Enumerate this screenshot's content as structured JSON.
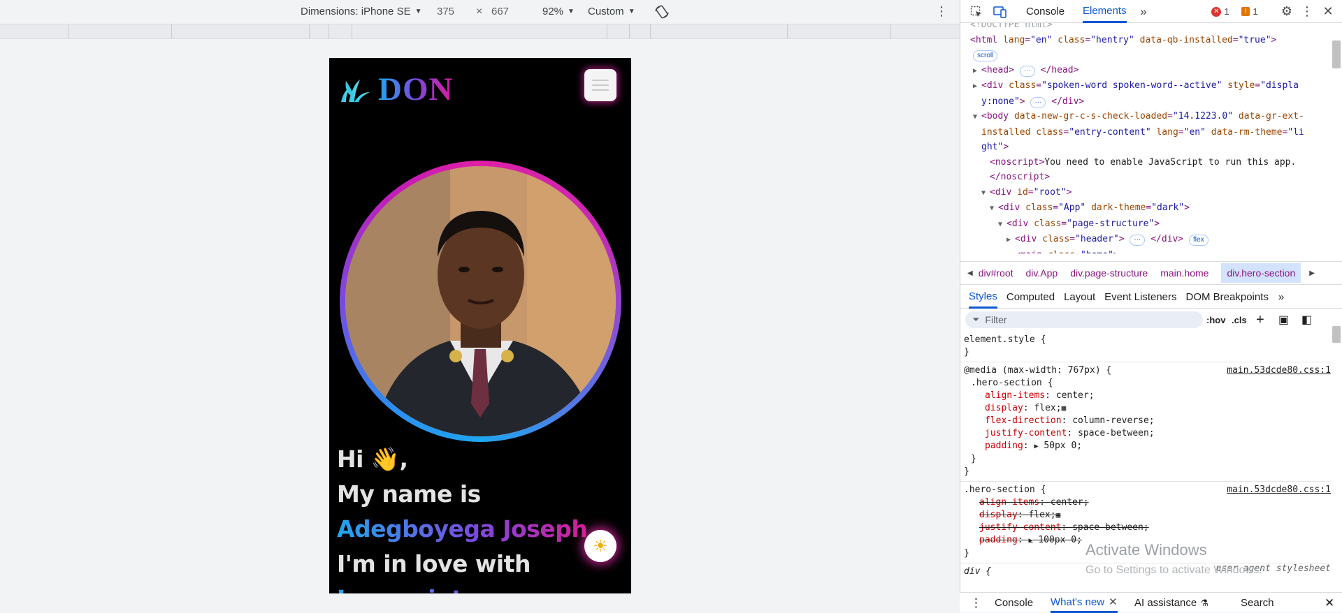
{
  "device_toolbar": {
    "dimensions_label": "Dimensions: iPhone SE",
    "width": "375",
    "times": "×",
    "height": "667",
    "zoom": "92%",
    "throttle": "Custom"
  },
  "site": {
    "logo_text": "DON",
    "greeting": "Hi 👋,",
    "line2": "My name is",
    "name": "Adegboyega Joseph",
    "line4": "I'm in love with",
    "line5": "Javascript"
  },
  "devtools": {
    "tabs": {
      "console": "Console",
      "elements": "Elements"
    },
    "error_count": "1",
    "warning_count": "1",
    "dom_lines": [
      "<!DOCTYPE html>"
    ],
    "breadcrumbs": [
      "div#root",
      "div.App",
      "div.page-structure",
      "main.home",
      "div.hero-section"
    ],
    "styles_tabs": [
      "Styles",
      "Computed",
      "Layout",
      "Event Listeners",
      "DOM Breakpoints"
    ],
    "filter_placeholder": "Filter",
    "hov": ":hov",
    "cls": ".cls",
    "element_style": "element.style {",
    "close_brace": "}",
    "media_query": "@media (max-width: 767px) {",
    "rule_selector": ".hero-section {",
    "source": "main.53dcde80.css:1",
    "rule1": [
      {
        "prop": "align-items",
        "val": "center;"
      },
      {
        "prop": "display",
        "val": "flex;"
      },
      {
        "prop": "flex-direction",
        "val": "column-reverse;"
      },
      {
        "prop": "justify-content",
        "val": "space-between;"
      },
      {
        "prop": "padding",
        "val": "50px 0;"
      }
    ],
    "rule2": [
      {
        "prop": "align-items",
        "val": "center;"
      },
      {
        "prop": "display",
        "val": "flex;"
      },
      {
        "prop": "justify-content",
        "val": "space-between;"
      },
      {
        "prop": "padding",
        "val": "100px 0;"
      }
    ],
    "div_rule": "div {",
    "user_agent": "user agent stylesheet",
    "drawer_tabs": {
      "console": "Console",
      "whats_new": "What's new",
      "ai": "AI assistance",
      "search": "Search"
    }
  },
  "watermark": {
    "title": "Activate Windows",
    "subtitle": "Go to Settings to activate Windows."
  }
}
